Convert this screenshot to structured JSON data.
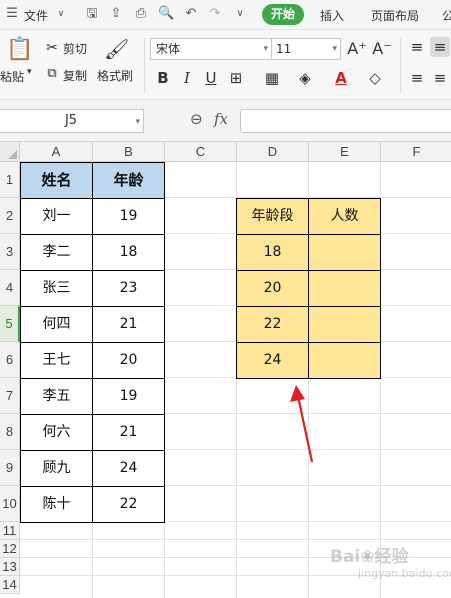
{
  "menubar": {
    "file": "文件",
    "tabs": [
      "开始",
      "插入",
      "页面布局",
      "公"
    ]
  },
  "ribbon": {
    "paste": "粘贴",
    "cut": "剪切",
    "copy": "复制",
    "format_painter": "格式刷",
    "font_name": "宋体",
    "font_size": "11",
    "bold": "B",
    "italic": "I",
    "underline": "U"
  },
  "formula_bar": {
    "cell_ref": "J5",
    "fx": "fx",
    "value": ""
  },
  "sheet": {
    "columns": [
      "A",
      "B",
      "C",
      "D",
      "E",
      "F"
    ],
    "rows": [
      "1",
      "2",
      "3",
      "4",
      "5",
      "6",
      "7",
      "8",
      "9",
      "10",
      "11",
      "12",
      "13",
      "14"
    ],
    "selected_row": "5",
    "table1": {
      "headers": [
        "姓名",
        "年龄"
      ],
      "rows": [
        [
          "刘一",
          "19"
        ],
        [
          "李二",
          "18"
        ],
        [
          "张三",
          "23"
        ],
        [
          "何四",
          "21"
        ],
        [
          "王七",
          "20"
        ],
        [
          "李五",
          "19"
        ],
        [
          "何六",
          "21"
        ],
        [
          "顾九",
          "24"
        ],
        [
          "陈十",
          "22"
        ]
      ]
    },
    "table2": {
      "headers": [
        "年龄段",
        "人数"
      ],
      "values": [
        "18",
        "20",
        "22",
        "24"
      ]
    }
  },
  "annotation": {
    "arrow_color": "#e02020"
  },
  "colors": {
    "accent": "#3fa64b",
    "header_fill": "#bdd7ee",
    "band_fill": "#ffe699"
  }
}
